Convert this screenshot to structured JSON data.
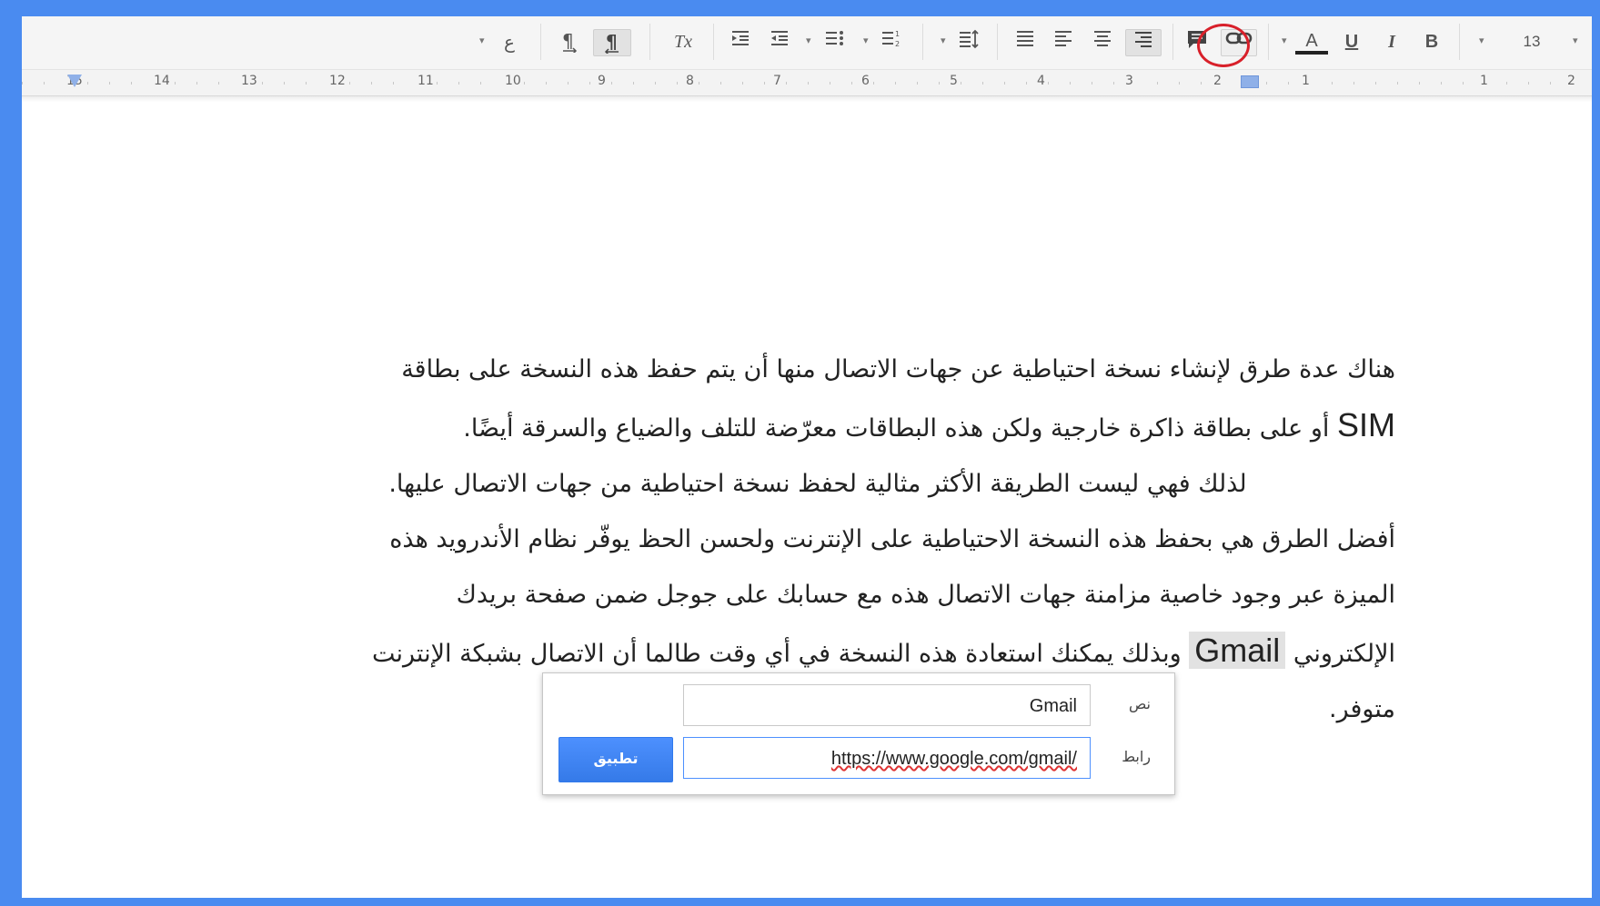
{
  "toolbar": {
    "font_size": "13",
    "bold_label": "B",
    "italic_label": "I",
    "underline_label": "U",
    "text_color_label": "A",
    "clear_format_label": "Tx",
    "arabic_menu_label": "ع"
  },
  "ruler": {
    "numbers": [
      "15",
      "14",
      "13",
      "12",
      "11",
      "10",
      "9",
      "8",
      "7",
      "6",
      "5",
      "4",
      "3",
      "2",
      "1",
      "1",
      "2"
    ]
  },
  "document": {
    "line1": "هناك عدة طرق لإنشاء نسخة احتياطية عن جهات الاتصال منها أن يتم حفظ هذه النسخة على بطاقة",
    "line2_latin": "SIM",
    "line2": " أو على بطاقة ذاكرة خارجية ولكن هذه البطاقات معرّضة للتلف والضياع والسرقة أيضًا.",
    "line3": "لذلك فهي ليست الطريقة الأكثر مثالية لحفظ نسخة احتياطية من جهات الاتصال عليها.",
    "line4": "أفضل الطرق هي بحفظ هذه النسخة الاحتياطية على الإنترنت ولحسن الحظ يوفّر نظام الأندرويد هذه",
    "line5": "الميزة عبر وجود خاصية مزامنة جهات الاتصال هذه مع حسابك على جوجل ضمن صفحة بريدك",
    "line6_a": "الإلكتروني ",
    "line6_link": "Gmail",
    "line6_b": " وبذلك يمكنك استعادة هذه النسخة في أي وقت طالما أن الاتصال بشبكة الإنترنت",
    "line7": "متوفر."
  },
  "link_popup": {
    "text_label": "نص",
    "text_value": "Gmail",
    "link_label": "رابط",
    "link_value": "https://www.google.com/gmail/",
    "apply_button": "تطبيق"
  },
  "colors": {
    "frame": "#4a8bf0",
    "highlight_circle": "#d8202a",
    "apply_button": "#4d90fe"
  }
}
